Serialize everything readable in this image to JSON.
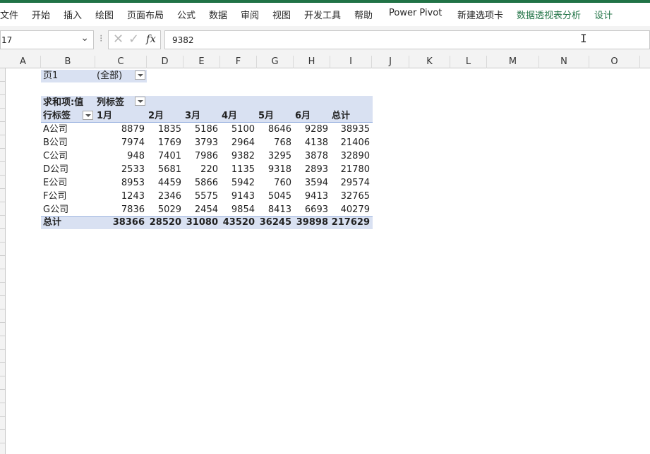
{
  "ribbon": {
    "tabs": [
      "文件",
      "开始",
      "插入",
      "绘图",
      "页面布局",
      "公式",
      "数据",
      "审阅",
      "视图",
      "开发工具",
      "帮助",
      "Power Pivot",
      "新建选项卡",
      "数据透视表分析",
      "设计"
    ],
    "context_color": "#217346"
  },
  "formula_bar": {
    "name_box": "17",
    "value": "9382",
    "fx": "fx"
  },
  "columns": [
    "A",
    "B",
    "C",
    "D",
    "E",
    "F",
    "G",
    "H",
    "I",
    "J",
    "K",
    "L",
    "M",
    "N",
    "O"
  ],
  "pivot": {
    "filter_label": "页1",
    "filter_value": "(全部)",
    "value_label": "求和项:值",
    "col_label": "列标签",
    "row_label": "行标签",
    "months": [
      "1月",
      "2月",
      "3月",
      "4月",
      "5月",
      "6月",
      "总计"
    ],
    "rows": [
      {
        "name": "A公司",
        "values": [
          "8879",
          "1835",
          "5186",
          "5100",
          "8646",
          "9289",
          "38935"
        ]
      },
      {
        "name": "B公司",
        "values": [
          "7974",
          "1769",
          "3793",
          "2964",
          "768",
          "4138",
          "21406"
        ]
      },
      {
        "name": "C公司",
        "values": [
          "948",
          "7401",
          "7986",
          "9382",
          "3295",
          "3878",
          "32890"
        ]
      },
      {
        "name": "D公司",
        "values": [
          "2533",
          "5681",
          "220",
          "1135",
          "9318",
          "2893",
          "21780"
        ]
      },
      {
        "name": "E公司",
        "values": [
          "8953",
          "4459",
          "5866",
          "5942",
          "760",
          "3594",
          "29574"
        ]
      },
      {
        "name": "F公司",
        "values": [
          "1243",
          "2346",
          "5575",
          "9143",
          "5045",
          "9413",
          "32765"
        ]
      },
      {
        "name": "G公司",
        "values": [
          "7836",
          "5029",
          "2454",
          "9854",
          "8413",
          "6693",
          "40279"
        ]
      }
    ],
    "total": {
      "name": "总计",
      "values": [
        "38366",
        "28520",
        "31080",
        "43520",
        "36245",
        "39898",
        "217629"
      ]
    },
    "band_color": "#d9e1f2"
  }
}
